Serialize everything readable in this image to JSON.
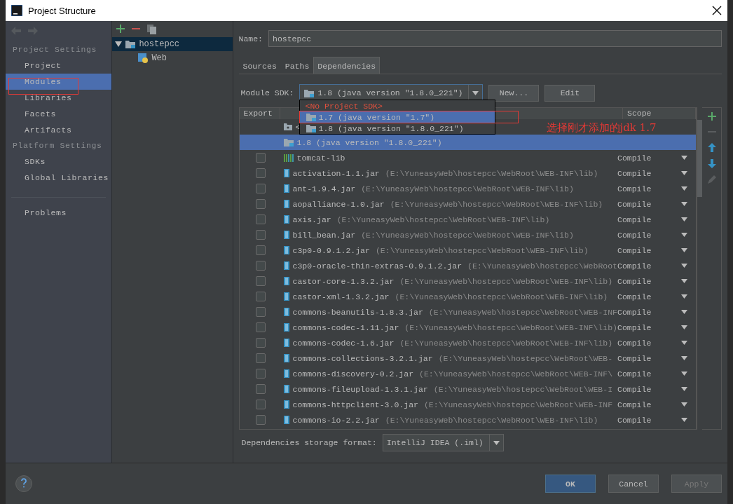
{
  "window": {
    "title": "Project Structure"
  },
  "sidebar": {
    "sections": [
      {
        "title": "Project Settings",
        "items": [
          {
            "label": "Project",
            "selected": false
          },
          {
            "label": "Modules",
            "selected": true
          },
          {
            "label": "Libraries",
            "selected": false
          },
          {
            "label": "Facets",
            "selected": false
          },
          {
            "label": "Artifacts",
            "selected": false
          }
        ]
      },
      {
        "title": "Platform Settings",
        "items": [
          {
            "label": "SDKs",
            "selected": false
          },
          {
            "label": "Global Libraries",
            "selected": false
          }
        ]
      }
    ],
    "footer_items": [
      {
        "label": "Problems",
        "selected": false
      }
    ]
  },
  "tree": [
    {
      "label": "hostepcc",
      "kind": "module",
      "expanded": true,
      "selected": true,
      "children": [
        {
          "label": "Web",
          "kind": "web",
          "selected": false
        }
      ]
    }
  ],
  "name_field": {
    "label": "Name:",
    "value": "hostepcc"
  },
  "tabs": [
    {
      "label": "Sources",
      "selected": false
    },
    {
      "label": "Paths",
      "selected": false
    },
    {
      "label": "Dependencies",
      "selected": true
    }
  ],
  "module_sdk": {
    "label": "Module SDK:",
    "value": "1.8 (java version \"1.8.0_221\")",
    "buttons": [
      "New...",
      "Edit"
    ]
  },
  "sdk_popup": [
    {
      "label": "<No Project SDK>",
      "kind": "none",
      "selected": false
    },
    {
      "label": "1.7 (java version \"1.7\")",
      "kind": "sdk",
      "selected": true
    },
    {
      "label": "1.8 (java version \"1.8.0_221\")",
      "kind": "sdk",
      "selected": false
    }
  ],
  "annotation": {
    "text": "选择刚才添加的jdk 1.7"
  },
  "table": {
    "columns": [
      "Export",
      "Scope"
    ],
    "rows": [
      {
        "kind": "source",
        "name": "<",
        "selected": false
      },
      {
        "kind": "sdk",
        "name": "1.8 (java version \"1.8.0_221\")",
        "selected": true
      },
      {
        "kind": "library",
        "name": "tomcat-lib",
        "checked": false,
        "scope": "Compile",
        "selected": false
      },
      {
        "kind": "jar",
        "name": "activation-1.1.jar",
        "path": "(E:\\YuneasyWeb\\hostepcc\\WebRoot\\WEB-INF\\lib)",
        "checked": false,
        "scope": "Compile",
        "selected": false
      },
      {
        "kind": "jar",
        "name": "ant-1.9.4.jar",
        "path": "(E:\\YuneasyWeb\\hostepcc\\WebRoot\\WEB-INF\\lib)",
        "checked": false,
        "scope": "Compile",
        "selected": false
      },
      {
        "kind": "jar",
        "name": "aopalliance-1.0.jar",
        "path": "(E:\\YuneasyWeb\\hostepcc\\WebRoot\\WEB-INF\\lib)",
        "checked": false,
        "scope": "Compile",
        "selected": false
      },
      {
        "kind": "jar",
        "name": "axis.jar",
        "path": "(E:\\YuneasyWeb\\hostepcc\\WebRoot\\WEB-INF\\lib)",
        "checked": false,
        "scope": "Compile",
        "selected": false
      },
      {
        "kind": "jar",
        "name": "bill_bean.jar",
        "path": "(E:\\YuneasyWeb\\hostepcc\\WebRoot\\WEB-INF\\lib)",
        "checked": false,
        "scope": "Compile",
        "selected": false
      },
      {
        "kind": "jar",
        "name": "c3p0-0.9.1.2.jar",
        "path": "(E:\\YuneasyWeb\\hostepcc\\WebRoot\\WEB-INF\\lib)",
        "checked": false,
        "scope": "Compile",
        "selected": false
      },
      {
        "kind": "jar",
        "name": "c3p0-oracle-thin-extras-0.9.1.2.jar",
        "path": "(E:\\YuneasyWeb\\hostepcc\\WebRoot",
        "checked": false,
        "scope": "Compile",
        "selected": false
      },
      {
        "kind": "jar",
        "name": "castor-core-1.3.2.jar",
        "path": "(E:\\YuneasyWeb\\hostepcc\\WebRoot\\WEB-INF\\lib)",
        "checked": false,
        "scope": "Compile",
        "selected": false
      },
      {
        "kind": "jar",
        "name": "castor-xml-1.3.2.jar",
        "path": "(E:\\YuneasyWeb\\hostepcc\\WebRoot\\WEB-INF\\lib)",
        "checked": false,
        "scope": "Compile",
        "selected": false
      },
      {
        "kind": "jar",
        "name": "commons-beanutils-1.8.3.jar",
        "path": "(E:\\YuneasyWeb\\hostepcc\\WebRoot\\WEB-INF",
        "checked": false,
        "scope": "Compile",
        "selected": false
      },
      {
        "kind": "jar",
        "name": "commons-codec-1.11.jar",
        "path": "(E:\\YuneasyWeb\\hostepcc\\WebRoot\\WEB-INF\\lib)",
        "checked": false,
        "scope": "Compile",
        "selected": false
      },
      {
        "kind": "jar",
        "name": "commons-codec-1.6.jar",
        "path": "(E:\\YuneasyWeb\\hostepcc\\WebRoot\\WEB-INF\\lib)",
        "checked": false,
        "scope": "Compile",
        "selected": false
      },
      {
        "kind": "jar",
        "name": "commons-collections-3.2.1.jar",
        "path": "(E:\\YuneasyWeb\\hostepcc\\WebRoot\\WEB-",
        "checked": false,
        "scope": "Compile",
        "selected": false
      },
      {
        "kind": "jar",
        "name": "commons-discovery-0.2.jar",
        "path": "(E:\\YuneasyWeb\\hostepcc\\WebRoot\\WEB-INF\\",
        "checked": false,
        "scope": "Compile",
        "selected": false
      },
      {
        "kind": "jar",
        "name": "commons-fileupload-1.3.1.jar",
        "path": "(E:\\YuneasyWeb\\hostepcc\\WebRoot\\WEB-I",
        "checked": false,
        "scope": "Compile",
        "selected": false
      },
      {
        "kind": "jar",
        "name": "commons-httpclient-3.0.jar",
        "path": "(E:\\YuneasyWeb\\hostepcc\\WebRoot\\WEB-INF",
        "checked": false,
        "scope": "Compile",
        "selected": false
      },
      {
        "kind": "jar",
        "name": "commons-io-2.2.jar",
        "path": "(E:\\YuneasyWeb\\hostepcc\\WebRoot\\WEB-INF\\lib)",
        "checked": false,
        "scope": "Compile",
        "selected": false
      }
    ]
  },
  "storage_format": {
    "label": "Dependencies storage format:",
    "value": "IntelliJ IDEA (.iml)"
  },
  "buttons": [
    {
      "label": "OK",
      "default": true,
      "disabled": false
    },
    {
      "label": "Cancel",
      "default": false,
      "disabled": false
    },
    {
      "label": "Apply",
      "default": false,
      "disabled": true
    }
  ]
}
